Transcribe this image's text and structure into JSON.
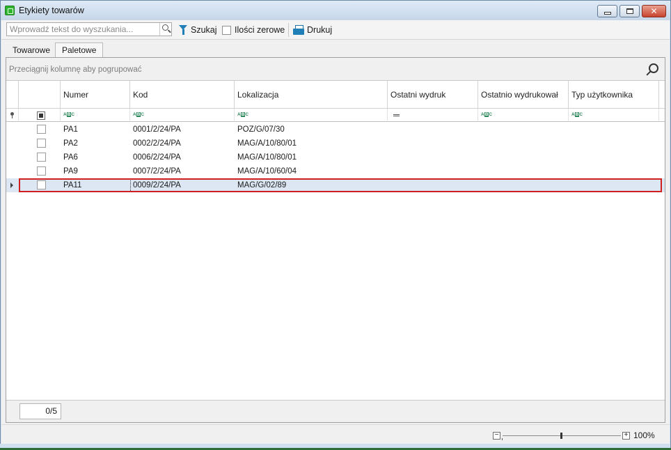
{
  "window": {
    "title": "Etykiety towarów",
    "close_glyph": "✕"
  },
  "toolbar": {
    "search_placeholder": "Wprowadź tekst do wyszukania...",
    "search_value": "",
    "search_button": "Szukaj",
    "zero_qty_label": "Ilości zerowe",
    "zero_qty_checked": false,
    "print_button": "Drukuj"
  },
  "tabs": [
    {
      "label": "Towarowe",
      "active": false
    },
    {
      "label": "Paletowe",
      "active": true
    }
  ],
  "grid": {
    "group_hint": "Przeciągnij kolumnę aby pogrupować",
    "columns": [
      "Numer",
      "Kod",
      "Lokalizacja",
      "Ostatni wydruk",
      "Ostatnio wydrukował",
      "Typ użytkownika"
    ],
    "filter_icons": [
      "abc",
      "abc",
      "abc",
      "eq",
      "abc",
      "abc"
    ],
    "filter_abc": {
      "a": "A",
      "b": "B",
      "c": "C"
    },
    "rows": [
      {
        "numer": "PA1",
        "kod": "0001/2/24/PA",
        "lokalizacja": "POZ/G/07/30",
        "ostatni_wydruk": "",
        "ostatnio_wydrukowal": "",
        "typ_uzytkownika": "",
        "checked": false
      },
      {
        "numer": "PA2",
        "kod": "0002/2/24/PA",
        "lokalizacja": "MAG/A/10/80/01",
        "ostatni_wydruk": "",
        "ostatnio_wydrukowal": "",
        "typ_uzytkownika": "",
        "checked": false
      },
      {
        "numer": "PA6",
        "kod": "0006/2/24/PA",
        "lokalizacja": "MAG/A/10/80/01",
        "ostatni_wydruk": "",
        "ostatnio_wydrukowal": "",
        "typ_uzytkownika": "",
        "checked": false
      },
      {
        "numer": "PA9",
        "kod": "0007/2/24/PA",
        "lokalizacja": "MAG/A/10/60/04",
        "ostatni_wydruk": "",
        "ostatnio_wydrukowal": "",
        "typ_uzytkownika": "",
        "checked": false
      },
      {
        "numer": "PA11",
        "kod": "0009/2/24/PA",
        "lokalizacja": "MAG/G/02/89",
        "ostatni_wydruk": "",
        "ostatnio_wydrukowal": "",
        "typ_uzytkownika": "",
        "checked": false
      }
    ],
    "selected_row": 4,
    "selection_count": "0/5"
  },
  "status": {
    "zoom_label": "100%",
    "zoom_minus": "−",
    "zoom_plus": "+"
  },
  "colors": {
    "selection_border": "#d11f1f",
    "selected_row_bg": "#dde7f3",
    "accent_blue": "#1f7fb6",
    "app_icon_green": "#2fb52f"
  }
}
